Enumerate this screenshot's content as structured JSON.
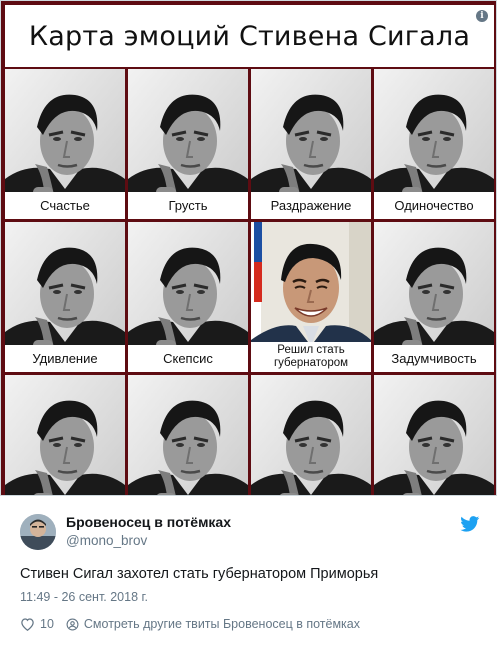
{
  "meme": {
    "title": "Карта эмоций Стивена Сигала",
    "info_icon": "info-icon",
    "cells": [
      {
        "caption": "Счастье",
        "variant": "serious"
      },
      {
        "caption": "Грусть",
        "variant": "serious"
      },
      {
        "caption": "Раздражение",
        "variant": "serious"
      },
      {
        "caption": "Одиночество",
        "variant": "serious"
      },
      {
        "caption": "Удивление",
        "variant": "serious"
      },
      {
        "caption": "Скепсис",
        "variant": "serious"
      },
      {
        "caption": "Решил стать губернатором",
        "variant": "smiling"
      },
      {
        "caption": "Задумчивость",
        "variant": "serious"
      },
      {
        "caption": "",
        "variant": "serious"
      },
      {
        "caption": "",
        "variant": "serious"
      },
      {
        "caption": "",
        "variant": "serious"
      },
      {
        "caption": "",
        "variant": "serious"
      }
    ],
    "colors": {
      "frame": "#5e0c12"
    }
  },
  "tweet": {
    "author_name": "Бровеносец в потёмках",
    "author_handle": "@mono_brov",
    "text": "Стивен Сигал захотел стать губернатором Приморья",
    "timestamp": "11:49 - 26 сент. 2018 г.",
    "like_count": "10",
    "more_tweets_label": "Смотреть другие твиты Бровеносец в потёмках",
    "brand_icon": "twitter-bird-icon",
    "colors": {
      "brand": "#1da1f2",
      "secondary_text": "#657786"
    }
  }
}
